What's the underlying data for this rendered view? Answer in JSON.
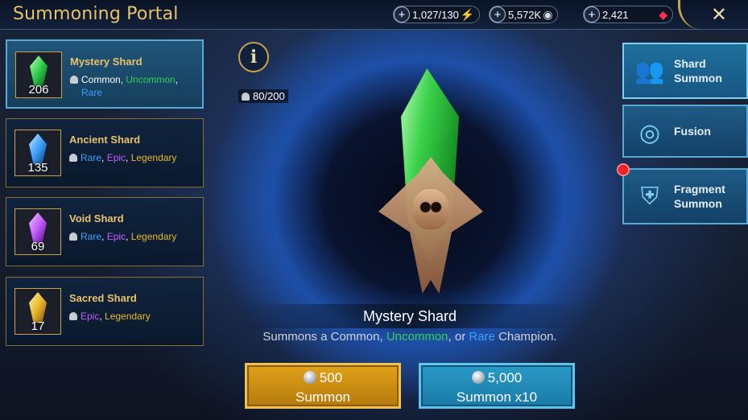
{
  "header": {
    "title": "Summoning Portal",
    "energy": "1,027/130",
    "silver": "5,572K",
    "gems": "2,421",
    "close_icon": "✕"
  },
  "shards": [
    {
      "name": "Mystery Shard",
      "count": "206",
      "color": "#2fd04d",
      "rarities": [
        {
          "t": "Common",
          "c": "common"
        },
        {
          "t": "Uncommon",
          "c": "uncommon"
        },
        {
          "t": "Rare",
          "c": "rare"
        }
      ]
    },
    {
      "name": "Ancient Shard",
      "count": "135",
      "color": "#3ca2ff",
      "rarities": [
        {
          "t": "Rare",
          "c": "rare"
        },
        {
          "t": "Epic",
          "c": "epic"
        },
        {
          "t": "Legendary",
          "c": "legendary"
        }
      ]
    },
    {
      "name": "Void Shard",
      "count": "69",
      "color": "#c45cff",
      "rarities": [
        {
          "t": "Rare",
          "c": "rare"
        },
        {
          "t": "Epic",
          "c": "epic"
        },
        {
          "t": "Legendary",
          "c": "legendary"
        }
      ]
    },
    {
      "name": "Sacred Shard",
      "count": "17",
      "color": "#e8b82a",
      "rarities": [
        {
          "t": "Epic",
          "c": "epic"
        },
        {
          "t": "Legendary",
          "c": "legendary"
        }
      ]
    }
  ],
  "info_icon": "i",
  "capacity": "80/200",
  "selected": {
    "title": "Mystery Shard",
    "desc_prefix": "Summons a ",
    "desc_common": "Common",
    "desc_sep1": ", ",
    "desc_uncommon": "Uncommon",
    "desc_sep2": ", or ",
    "desc_rare": "Rare",
    "desc_suffix": " Champion."
  },
  "tabs": [
    {
      "label_1": "Shard",
      "label_2": "Summon",
      "icon": "shard-summon-icon"
    },
    {
      "label_1": "Fusion",
      "label_2": "",
      "icon": "fusion-icon"
    },
    {
      "label_1": "Fragment",
      "label_2": "Summon",
      "icon": "fragment-summon-icon"
    }
  ],
  "buttons": {
    "summon_cost": "500",
    "summon_label": "Summon",
    "summon10_cost": "5,000",
    "summon10_label": "Summon x10"
  }
}
